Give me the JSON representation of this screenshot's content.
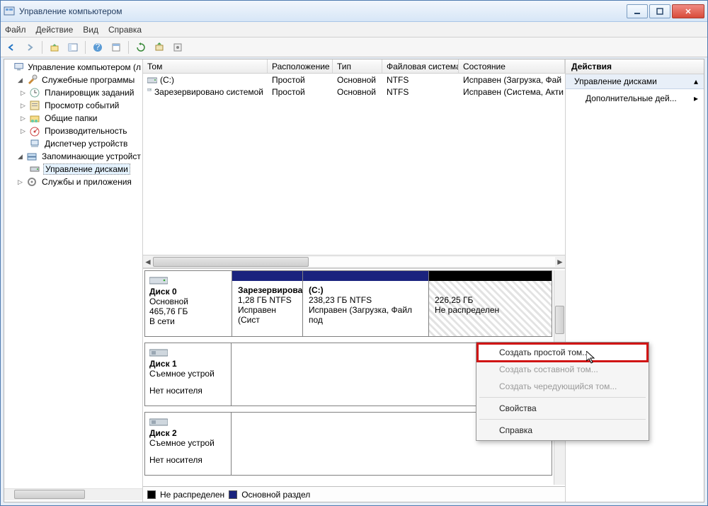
{
  "window": {
    "title": "Управление компьютером"
  },
  "menu": {
    "file": "Файл",
    "action": "Действие",
    "view": "Вид",
    "help": "Справка"
  },
  "tree": {
    "root": "Управление компьютером (л",
    "sys_tools": "Служебные программы",
    "task_sched": "Планировщик заданий",
    "event_viewer": "Просмотр событий",
    "shared": "Общие папки",
    "perf": "Производительность",
    "devmgr": "Диспетчер устройств",
    "storage": "Запоминающие устройст",
    "diskmgmt": "Управление дисками",
    "services": "Службы и приложения"
  },
  "columns": {
    "volume": "Том",
    "layout": "Расположение",
    "type": "Тип",
    "fs": "Файловая система",
    "status": "Состояние"
  },
  "volumes": [
    {
      "name": "(C:)",
      "layout": "Простой",
      "type": "Основной",
      "fs": "NTFS",
      "status": "Исправен (Загрузка, Фай"
    },
    {
      "name": "Зарезервировано системой",
      "layout": "Простой",
      "type": "Основной",
      "fs": "NTFS",
      "status": "Исправен (Система, Акти"
    }
  ],
  "disks": {
    "d0": {
      "name": "Диск 0",
      "type": "Основной",
      "size": "465,76 ГБ",
      "status": "В сети",
      "p1": {
        "name": "Зарезервирова",
        "l2": "1,28 ГБ NTFS",
        "l3": "Исправен (Сист"
      },
      "p2": {
        "name": "(C:)",
        "l2": "238,23 ГБ NTFS",
        "l3": "Исправен (Загрузка, Файл под"
      },
      "p3": {
        "l2": "226,25 ГБ",
        "l3": "Не распределен"
      }
    },
    "d1": {
      "name": "Диск 1",
      "type": "Съемное устрой",
      "status": "Нет носителя"
    },
    "d2": {
      "name": "Диск 2",
      "type": "Съемное устрой",
      "status": "Нет носителя"
    }
  },
  "legend": {
    "unalloc": "Не распределен",
    "primary": "Основной раздел"
  },
  "actions": {
    "header": "Действия",
    "diskmgmt": "Управление дисками",
    "more": "Дополнительные дей..."
  },
  "ctx": {
    "simple": "Создать простой том...",
    "spanned": "Создать составной том...",
    "striped": "Создать чередующийся том...",
    "props": "Свойства",
    "help": "Справка"
  }
}
